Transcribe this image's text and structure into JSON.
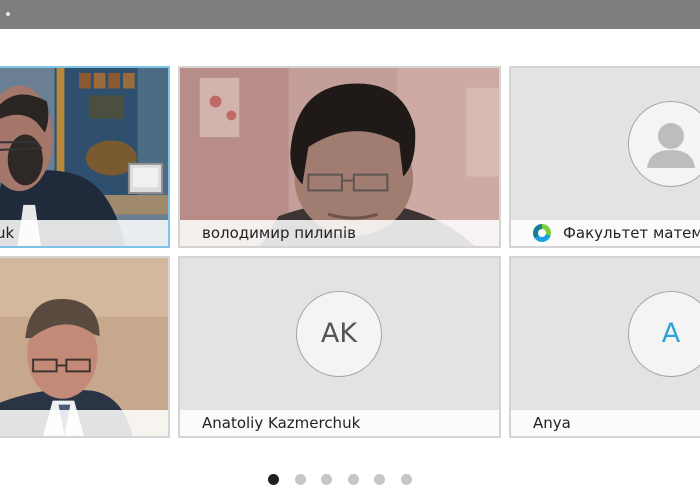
{
  "participants": [
    {
      "name": "uk"
    },
    {
      "name": "володимир пилипів"
    },
    {
      "name": "Факультет матема"
    },
    {
      "name": ""
    },
    {
      "name": "Anatoliy Kazmerchuk",
      "initials": "AK"
    },
    {
      "name": "Anya",
      "initials": "A"
    }
  ],
  "pagination": {
    "total": 6,
    "current": 1
  },
  "colors": {
    "active_border": "#7ec3e6",
    "avatar_initial_blue": "#2fa3d6",
    "topbar": "#7d7d7d"
  },
  "icons": {
    "default_avatar": "person-silhouette-icon",
    "presenter_status": "presenter-status-icon"
  }
}
